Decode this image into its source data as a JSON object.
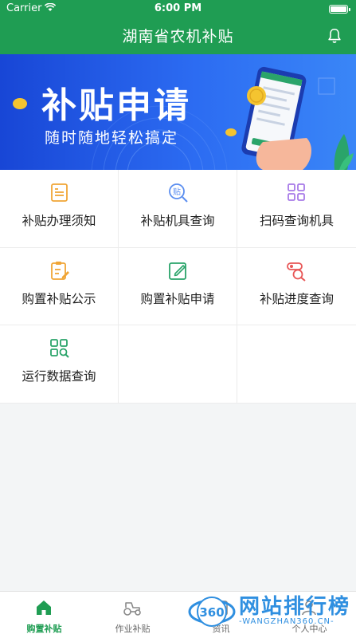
{
  "status_bar": {
    "carrier": "Carrier",
    "time": "6:00 PM"
  },
  "header": {
    "title": "湖南省农机补贴"
  },
  "banner": {
    "title": "补贴申请",
    "subtitle": "随时随地轻松搞定"
  },
  "grid_items": [
    {
      "label": "补贴办理须知",
      "icon": "document-icon",
      "color": "#f0a536"
    },
    {
      "label": "补贴机具查询",
      "icon": "subsidy-search-icon",
      "color": "#5b8ef0"
    },
    {
      "label": "扫码查询机具",
      "icon": "qr-scan-icon",
      "color": "#a77ae8"
    },
    {
      "label": "购置补贴公示",
      "icon": "clipboard-edit-icon",
      "color": "#f0a536"
    },
    {
      "label": "购置补贴申请",
      "icon": "edit-icon",
      "color": "#2aa46a"
    },
    {
      "label": "补贴进度查询",
      "icon": "progress-search-icon",
      "color": "#e85656"
    },
    {
      "label": "运行数据查询",
      "icon": "grid-search-icon",
      "color": "#2aa46a"
    }
  ],
  "tabbar": {
    "tabs": [
      {
        "label": "购置补贴",
        "icon": "home-icon",
        "active": true
      },
      {
        "label": "作业补贴",
        "icon": "tractor-icon",
        "active": false
      },
      {
        "label": "资讯",
        "icon": "news-icon",
        "active": false
      },
      {
        "label": "个人中心",
        "icon": "user-icon",
        "active": false
      }
    ]
  },
  "watermark": {
    "text": "网站排行榜",
    "badge": "360",
    "url": "-WANGZHAN360.CN-"
  },
  "colors": {
    "primary": "#1f9d53",
    "banner_blue": "#2c6cf2",
    "background": "#f3f5f6"
  }
}
